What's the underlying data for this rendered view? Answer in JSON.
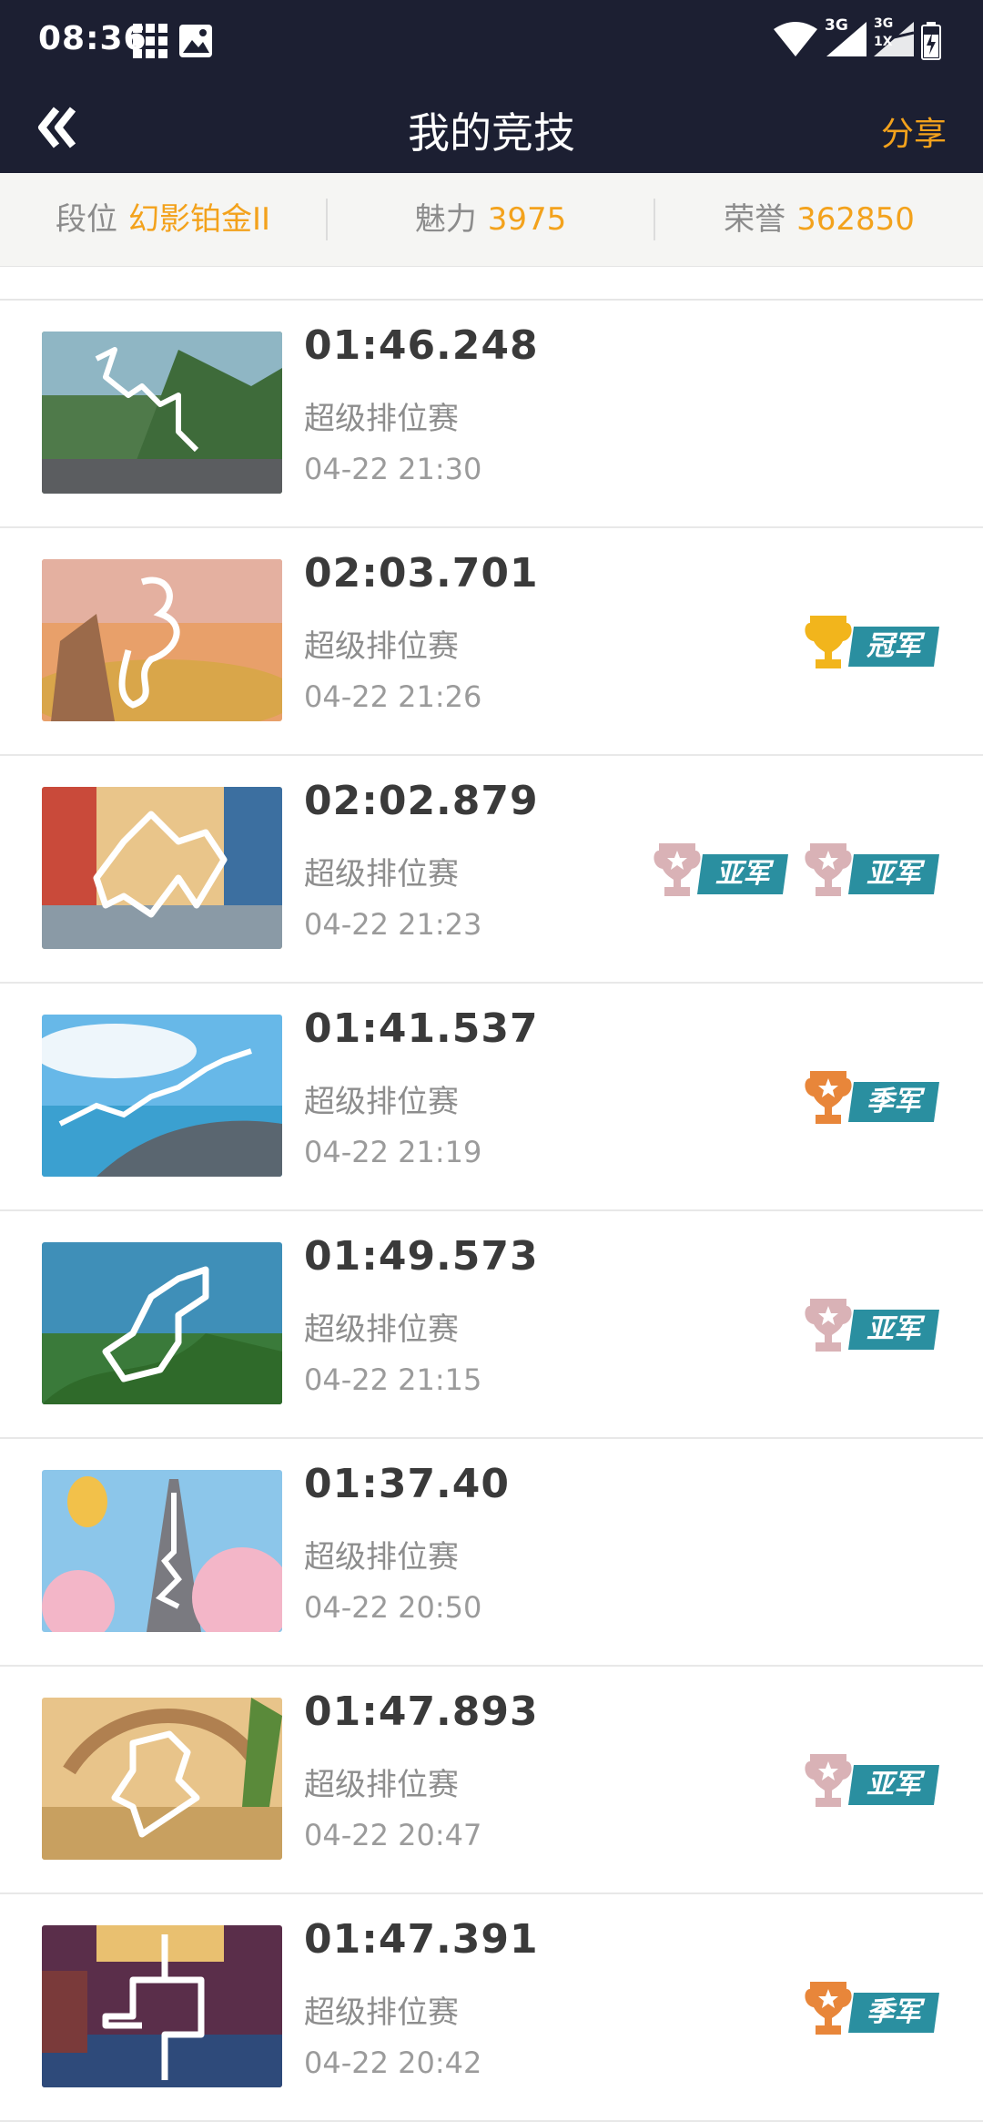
{
  "status_bar": {
    "time": "08:36",
    "network_1": "3G",
    "network_2": "3G",
    "sim_2": "1X"
  },
  "header": {
    "title": "我的竞技",
    "share": "分享"
  },
  "stats": {
    "rank_label": "段位",
    "rank_value": "幻影铂金II",
    "charm_label": "魅力",
    "charm_value": "3975",
    "honor_label": "荣誉",
    "honor_value": "362850"
  },
  "records": [
    {
      "time": "01:46.248",
      "mode": "超级排位赛",
      "date": "04-22 21:30",
      "badges": []
    },
    {
      "time": "02:03.701",
      "mode": "超级排位赛",
      "date": "04-22 21:26",
      "badges": [
        "冠军"
      ]
    },
    {
      "time": "02:02.879",
      "mode": "超级排位赛",
      "date": "04-22 21:23",
      "badges": [
        "亚军",
        "亚军"
      ]
    },
    {
      "time": "01:41.537",
      "mode": "超级排位赛",
      "date": "04-22 21:19",
      "badges": [
        "季军"
      ]
    },
    {
      "time": "01:49.573",
      "mode": "超级排位赛",
      "date": "04-22 21:15",
      "badges": [
        "亚军"
      ]
    },
    {
      "time": "01:37.40",
      "mode": "超级排位赛",
      "date": "04-22 20:50",
      "badges": []
    },
    {
      "time": "01:47.893",
      "mode": "超级排位赛",
      "date": "04-22 20:47",
      "badges": [
        "亚军"
      ]
    },
    {
      "time": "01:47.391",
      "mode": "超级排位赛",
      "date": "04-22 20:42",
      "badges": [
        "季军"
      ]
    }
  ],
  "colors": {
    "accent": "#f3a21c",
    "header_bg": "#1c1f32",
    "badge_label": "#2a8fa0",
    "gold": "#f2b51c",
    "silver": "#d9b2b6",
    "bronze": "#e8863a"
  }
}
